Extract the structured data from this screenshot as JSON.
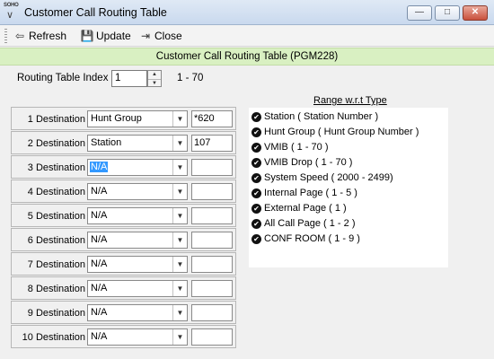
{
  "window": {
    "title": "Customer Call Routing Table",
    "icon_text": "SOHO",
    "icon_glyph": "∨"
  },
  "window_controls": {
    "minimize": "—",
    "maximize": "□",
    "close": "✕"
  },
  "toolbar": {
    "refresh": {
      "label": "Refresh",
      "icon": "⇦"
    },
    "update": {
      "label": "Update",
      "icon": "💾"
    },
    "close": {
      "label": "Close",
      "icon": "⇥"
    }
  },
  "banner": "Customer Call Routing Table (PGM228)",
  "routing_index": {
    "label": "Routing Table Index",
    "value": "1",
    "range": "1 - 70",
    "up": "▲",
    "down": "▼"
  },
  "destinations": [
    {
      "label": "1 Destination",
      "type": "Hunt Group",
      "value": "*620"
    },
    {
      "label": "2 Destination",
      "type": "Station",
      "value": "107"
    },
    {
      "label": "3 Destination",
      "type": "N/A",
      "value": ""
    },
    {
      "label": "4 Destination",
      "type": "N/A",
      "value": ""
    },
    {
      "label": "5 Destination",
      "type": "N/A",
      "value": ""
    },
    {
      "label": "6 Destination",
      "type": "N/A",
      "value": ""
    },
    {
      "label": "7 Destination",
      "type": "N/A",
      "value": ""
    },
    {
      "label": "8 Destination",
      "type": "N/A",
      "value": ""
    },
    {
      "label": "9 Destination",
      "type": "N/A",
      "value": ""
    },
    {
      "label": "10 Destination",
      "type": "N/A",
      "value": ""
    }
  ],
  "dropdown_arrow": "▼",
  "range": {
    "title": "Range w.r.t Type",
    "check_glyph": "✔",
    "items": [
      "Station ( Station Number )",
      "Hunt Group ( Hunt Group Number )",
      "VMIB ( 1 - 70 )",
      "VMIB Drop ( 1 - 70 )",
      "System Speed ( 2000 - 2499)",
      "Internal Page ( 1 - 5 )",
      "External Page ( 1 )",
      "All Call Page ( 1 - 2 )",
      "CONF ROOM ( 1 - 9 )"
    ]
  },
  "colors": {
    "banner_bg": "#d9f0c2",
    "selection": "#3399ff"
  }
}
